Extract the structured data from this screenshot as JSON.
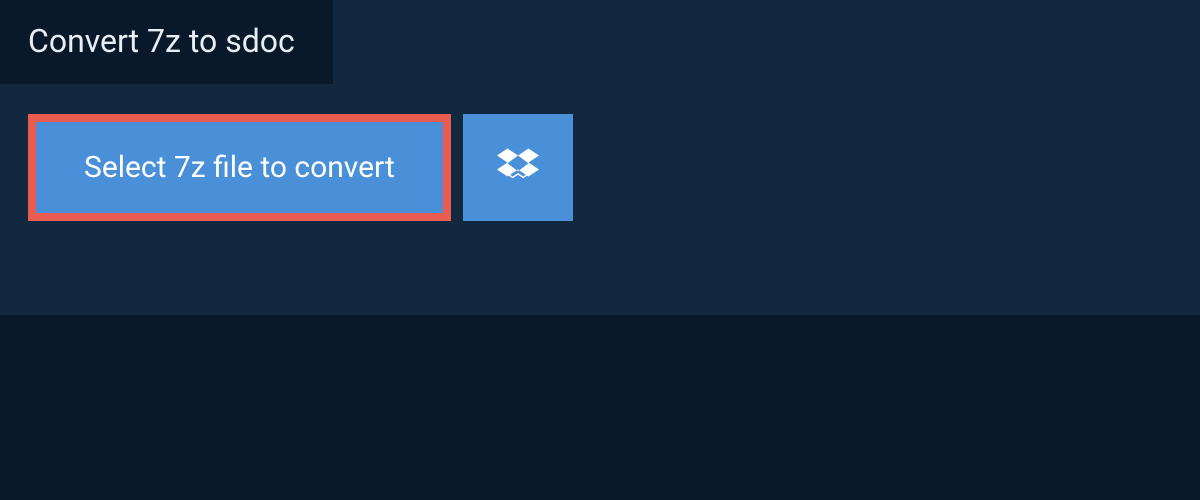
{
  "title": "Convert 7z to sdoc",
  "actions": {
    "select_label": "Select 7z file to convert"
  }
}
